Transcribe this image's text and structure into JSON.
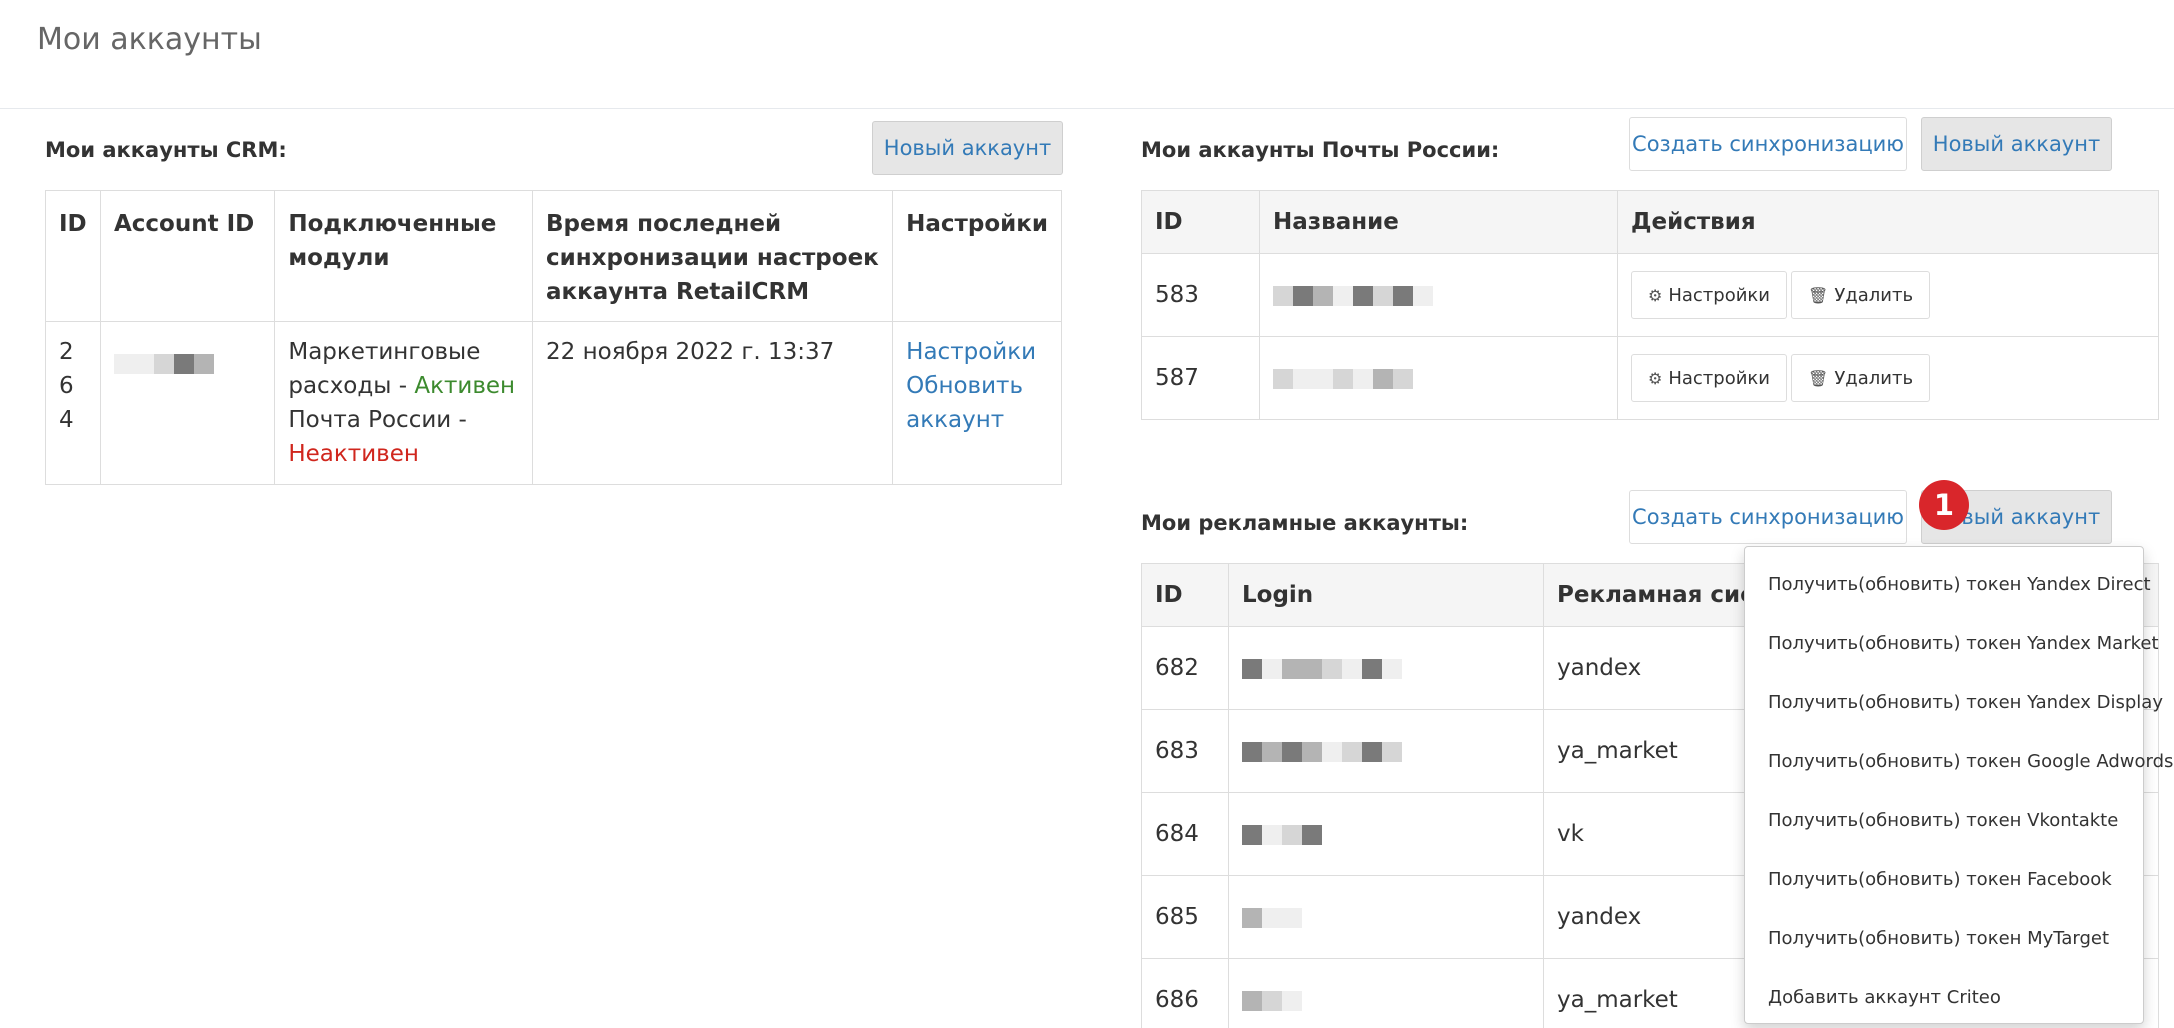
{
  "page": {
    "title": "Мои аккаунты"
  },
  "crm": {
    "label": "Мои аккаунты CRM:",
    "new_button": "Новый аккаунт",
    "headers": [
      "ID",
      "Account ID",
      "Подключенные модули",
      "Время последней синхронизации настроек аккаунта RetailCRM",
      "Настройки"
    ],
    "rows": [
      {
        "id": "264",
        "modules": [
          {
            "name": "Маркетинговые расходы - ",
            "status": "Активен"
          },
          {
            "name": "Почта России - ",
            "status": "Неактивен"
          }
        ],
        "sync_time": "22 ноября 2022 г. 13:37",
        "settings_link": "Настройки",
        "update_link": "Обновить аккаунт"
      }
    ]
  },
  "post": {
    "label": "Мои аккаунты Почты России:",
    "sync_button": "Создать синхронизацию",
    "new_button": "Новый аккаунт",
    "headers": [
      "ID",
      "Название",
      "Действия"
    ],
    "rows": [
      {
        "id": "583",
        "settings": "Настройки",
        "delete": "Удалить"
      },
      {
        "id": "587",
        "settings": "Настройки",
        "delete": "Удалить"
      }
    ]
  },
  "ads": {
    "label": "Мои рекламные аккаунты:",
    "sync_button": "Создать синхронизацию",
    "new_button": "Новый аккаунт",
    "headers": [
      "ID",
      "Login",
      "Рекламная систем"
    ],
    "rows": [
      {
        "id": "682",
        "system": "yandex"
      },
      {
        "id": "683",
        "system": "ya_market"
      },
      {
        "id": "684",
        "system": "vk"
      },
      {
        "id": "685",
        "system": "yandex"
      },
      {
        "id": "686",
        "system": "ya_market"
      }
    ]
  },
  "dropdown": {
    "items": [
      "Получить(обновить) токен Yandex Direct",
      "Получить(обновить) токен Yandex Market",
      "Получить(обновить) токен Yandex Display",
      "Получить(обновить) токен Google Adwords",
      "Получить(обновить) токен Vkontakte",
      "Получить(обновить) токен Facebook",
      "Получить(обновить) токен MyTarget",
      "Добавить аккаунт Criteo"
    ]
  },
  "annotation": {
    "badge": "1",
    "color": "#d9262b"
  },
  "colors": {
    "link": "#337ab7",
    "active": "#3c8a2e",
    "inactive": "#d0261d"
  }
}
